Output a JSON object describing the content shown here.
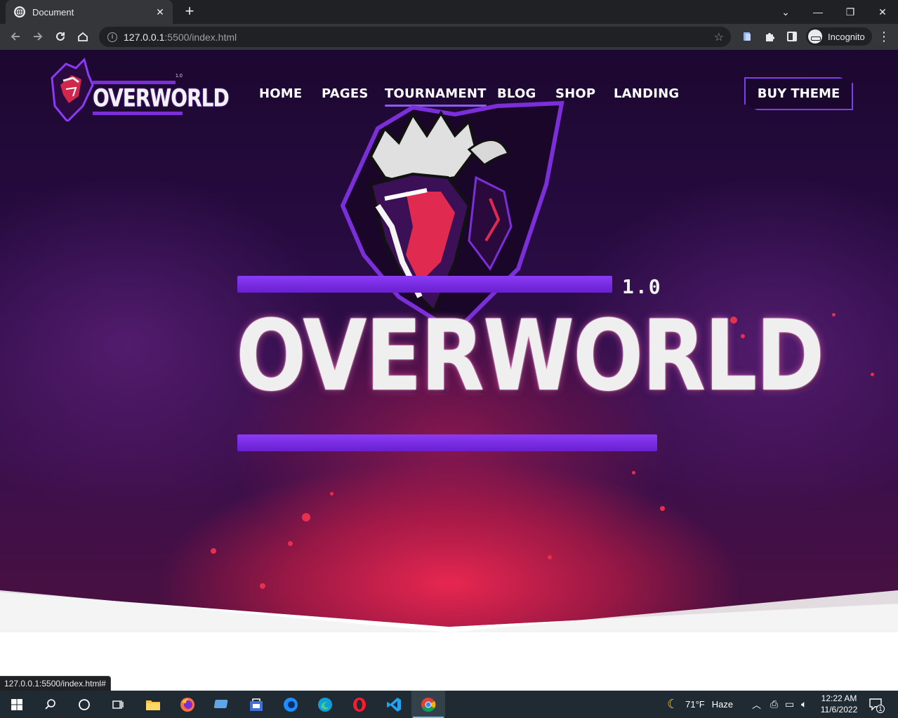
{
  "browser": {
    "tab_title": "Document",
    "url_host": "127.0.0.1",
    "url_path": ":5500/index.html",
    "profile_label": "Incognito",
    "status_url": "127.0.0.1:5500/index.html#"
  },
  "site": {
    "brand_name": "OVERWORLD",
    "brand_version": "1.0",
    "nav": [
      {
        "label": "HOME",
        "active": false
      },
      {
        "label": "PAGES",
        "active": false
      },
      {
        "label": "TOURNAMENT",
        "active": true
      },
      {
        "label": "BLOG",
        "active": false
      },
      {
        "label": "SHOP",
        "active": false
      },
      {
        "label": "LANDING",
        "active": false
      }
    ],
    "cta_label": "BUY THEME",
    "hero_title": "OVERWORLD",
    "hero_version": "1.0",
    "colors": {
      "accent": "#7b2fd8",
      "red": "#e8304e",
      "bg": "#2a0c44"
    }
  },
  "taskbar": {
    "weather_temp": "71°F",
    "weather_text": "Haze",
    "time": "12:22 AM",
    "date": "11/6/2022",
    "notification_count": "1",
    "apps": [
      "start-icon",
      "search-icon",
      "cortana-icon",
      "task-view-icon",
      "file-explorer-icon",
      "firefox-icon",
      "remote-desktop-icon",
      "store-icon",
      "firefox-dev-icon",
      "edge-icon",
      "opera-icon",
      "vscode-icon",
      "chrome-icon"
    ]
  }
}
